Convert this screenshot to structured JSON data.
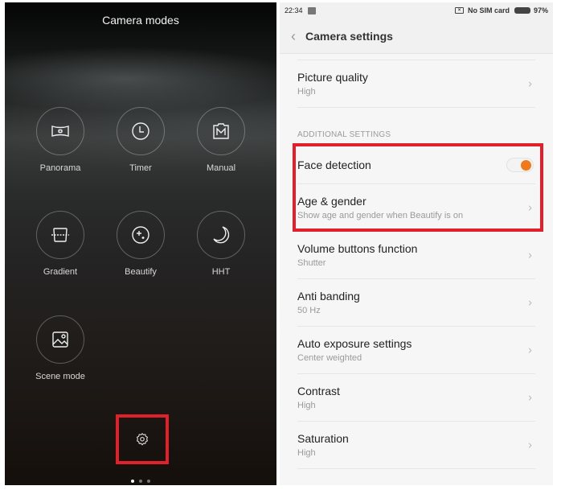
{
  "camera_modes": {
    "title": "Camera modes",
    "modes": [
      {
        "label": "Panorama",
        "icon": "panorama-icon"
      },
      {
        "label": "Timer",
        "icon": "timer-icon"
      },
      {
        "label": "Manual",
        "icon": "manual-icon"
      },
      {
        "label": "Gradient",
        "icon": "gradient-icon"
      },
      {
        "label": "Beautify",
        "icon": "beautify-icon"
      },
      {
        "label": "HHT",
        "icon": "moon-icon"
      },
      {
        "label": "Scene mode",
        "icon": "image-icon"
      }
    ],
    "settings_icon": "gear-icon",
    "page_indicator": {
      "pages": 3,
      "current": 1
    }
  },
  "status_bar": {
    "time": "22:34",
    "sim_status": "No SIM card",
    "battery": "97%"
  },
  "settings": {
    "title": "Camera settings",
    "back_icon": "chevron-left-icon",
    "picture_quality": {
      "title": "Picture quality",
      "value": "High"
    },
    "section_header": "ADDITIONAL SETTINGS",
    "face_detection": {
      "title": "Face detection",
      "enabled": true
    },
    "items": [
      {
        "title": "Age & gender",
        "value": "Show age and gender when Beautify is on"
      },
      {
        "title": "Volume buttons function",
        "value": "Shutter"
      },
      {
        "title": "Anti banding",
        "value": "50 Hz"
      },
      {
        "title": "Auto exposure settings",
        "value": "Center weighted"
      },
      {
        "title": "Contrast",
        "value": "High"
      },
      {
        "title": "Saturation",
        "value": "High"
      }
    ],
    "accent_color": "#f07a19",
    "highlight_color": "#e0212b"
  }
}
